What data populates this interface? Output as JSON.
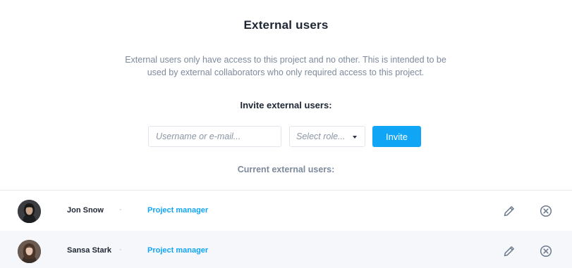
{
  "page": {
    "title": "External users",
    "description": "External users only have access to this project and no other. This is intended to be used by external collaborators who only required access to this project."
  },
  "invite": {
    "heading": "Invite external users:",
    "input_placeholder": "Username or e-mail...",
    "role_placeholder": "Select role...",
    "button_label": "Invite"
  },
  "current": {
    "heading": "Current external users:",
    "separator": "·",
    "users": [
      {
        "name": "Jon Snow",
        "role": "Project manager",
        "avatar_icon": "user-avatar"
      },
      {
        "name": "Sansa Stark",
        "role": "Project manager",
        "avatar_icon": "user-avatar"
      }
    ]
  },
  "colors": {
    "accent": "#10a5f5",
    "heading": "#1e2633",
    "muted": "#7d8a9c",
    "row_alt": "#f5f7fa",
    "border": "#e1e5eb"
  },
  "icons": {
    "edit": "pencil-icon",
    "remove": "close-circle-icon",
    "dropdown": "caret-down-icon"
  }
}
